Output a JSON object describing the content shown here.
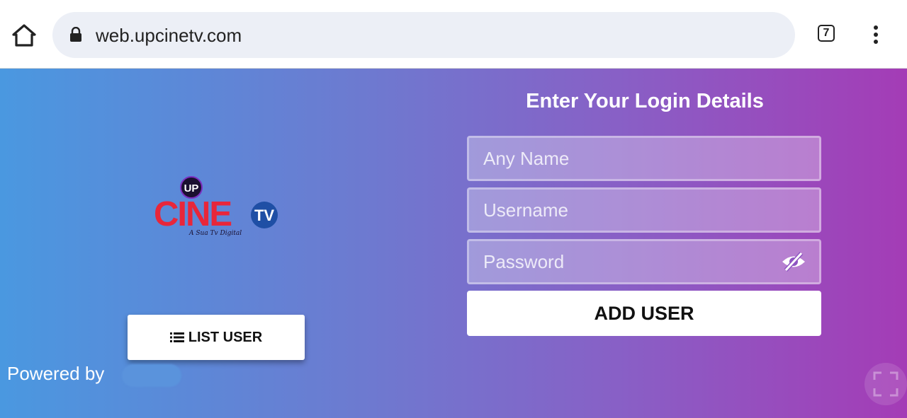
{
  "browser": {
    "url": "web.upcinetv.com",
    "tab_count": "7",
    "icons": {
      "home": "home-icon",
      "lock": "lock-icon",
      "menu": "more-vert-icon"
    }
  },
  "logo": {
    "badge": "UP",
    "name_part1": "CINE",
    "name_part2": "TV",
    "tagline": "A Sua Tv Digital"
  },
  "left": {
    "list_user_label": "LIST USER",
    "powered_by": "Powered by"
  },
  "login": {
    "title": "Enter Your Login Details",
    "name_placeholder": "Any Name",
    "username_placeholder": "Username",
    "password_placeholder": "Password",
    "add_user_label": "ADD USER"
  },
  "colors": {
    "gradient_start": "#4a98e0",
    "gradient_end": "#a43cb6",
    "logo_red": "#e8263a",
    "logo_blue": "#1f4fa5"
  }
}
